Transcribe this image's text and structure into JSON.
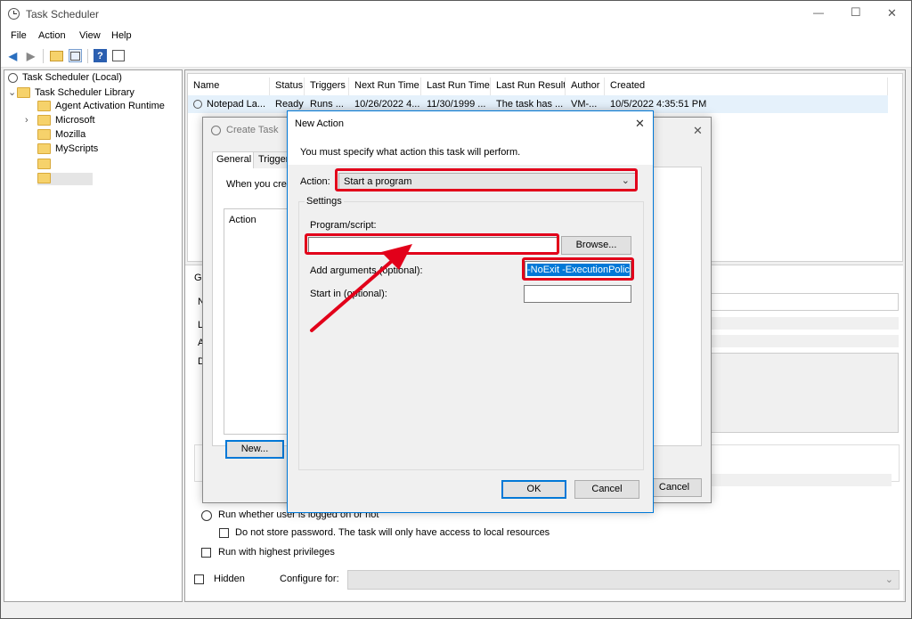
{
  "window": {
    "title": "Task Scheduler",
    "minimize_glyph": "—",
    "maximize_glyph": "☐",
    "close_glyph": "✕"
  },
  "menu": {
    "file": "File",
    "action": "Action",
    "view": "View",
    "help": "Help"
  },
  "toolbar": {
    "back": "back-arrow-icon",
    "forward": "forward-arrow-icon",
    "up": "up-folder-icon",
    "show_hide": "show-hide-tree-icon",
    "help": "help-icon",
    "properties": "properties-icon"
  },
  "tree": {
    "root": "Task Scheduler (Local)",
    "library": "Task Scheduler Library",
    "items": [
      "Agent Activation Runtime",
      "Microsoft",
      "Mozilla",
      "MyScripts",
      "",
      ""
    ]
  },
  "task_list": {
    "columns": [
      "Name",
      "Status",
      "Triggers",
      "Next Run Time",
      "Last Run Time",
      "Last Run Result",
      "Author",
      "Created"
    ],
    "rows": [
      [
        "Notepad La...",
        "Ready",
        "Runs ...",
        "10/26/2022 4...",
        "11/30/1999 ...",
        "The task has ...",
        "VM-...",
        "10/5/2022 4:35:51 PM"
      ]
    ]
  },
  "background_form": {
    "tab_prefix": "Ge",
    "letters": [
      "N",
      "L",
      "A",
      "D"
    ],
    "run_logged": "Run whether user is logged on or not",
    "no_store_password": "Do not store password.  The task will only have access to local resources",
    "highest_privileges": "Run with highest privileges",
    "hidden": "Hidden",
    "configure_for": "Configure for:"
  },
  "create_task": {
    "title": "Create Task",
    "close_glyph": "✕",
    "tabs": [
      "General",
      "Trigger"
    ],
    "intro": "When you crea",
    "action_column": "Action",
    "new_button": "New...",
    "cancel_button": "Cancel"
  },
  "new_action": {
    "title": "New Action",
    "close_glyph": "✕",
    "instruction": "You must specify what action this task will perform.",
    "action_label": "Action:",
    "action_value": "Start a program",
    "settings_label": "Settings",
    "program_label": "Program/script:",
    "program_value": "",
    "browse_button": "Browse...",
    "args_label": "Add arguments (optional):",
    "args_value": "-NoExit -ExecutionPolic",
    "start_in_label": "Start in (optional):",
    "start_in_value": "",
    "ok_button": "OK",
    "cancel_button": "Cancel"
  },
  "colors": {
    "highlight": "#e2001a",
    "selection": "#0078d7",
    "accent": "#0078d7"
  }
}
